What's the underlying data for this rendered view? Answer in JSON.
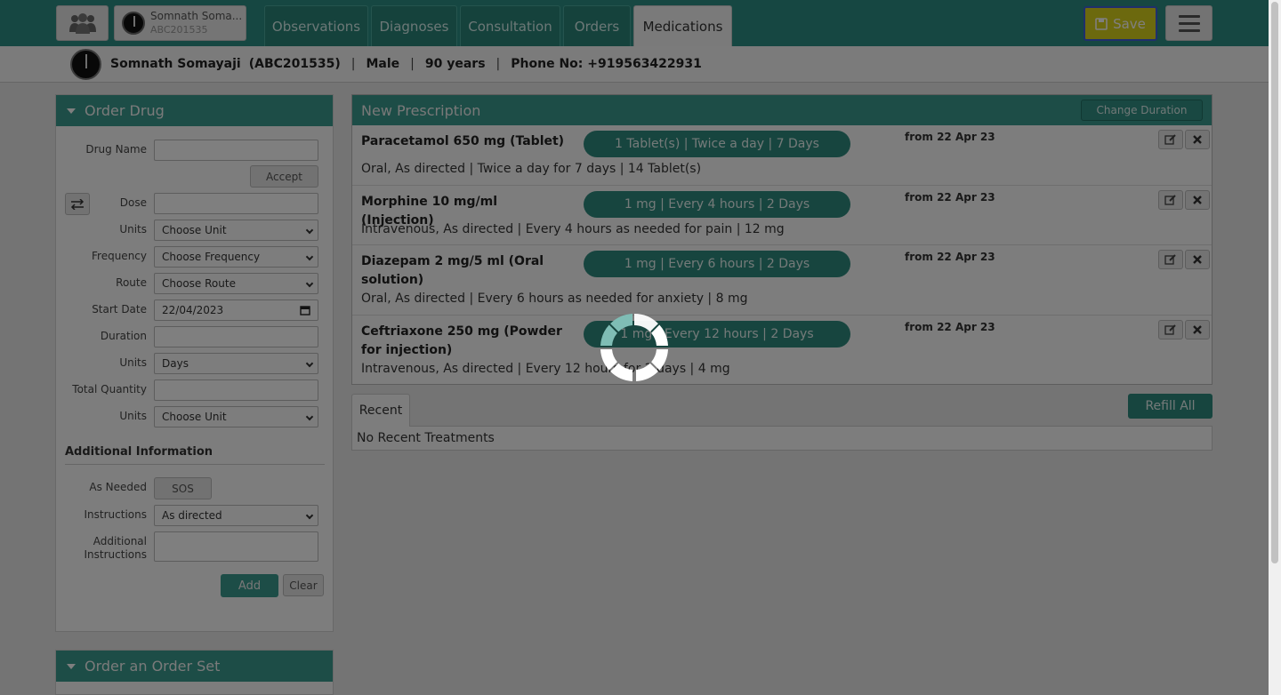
{
  "topbar": {
    "patient_chip": {
      "name": "Somnath Soma...",
      "id": "ABC201535"
    },
    "tabs": [
      {
        "label": "Observations"
      },
      {
        "label": "Diagnoses"
      },
      {
        "label": "Consultation"
      },
      {
        "label": "Orders"
      },
      {
        "label": "Medications"
      }
    ],
    "active_tab": "Medications",
    "save_label": "Save"
  },
  "patient_header": {
    "name": "Somnath Somayaji",
    "id": "(ABC201535)",
    "gender": "Male",
    "age": "90 years",
    "phone": "Phone No: +919563422931"
  },
  "order_drug": {
    "title": "Order Drug",
    "labels": {
      "drug_name": "Drug Name",
      "dose": "Dose",
      "units": "Units",
      "frequency": "Frequency",
      "route": "Route",
      "start_date": "Start Date",
      "duration": "Duration",
      "duration_units": "Units",
      "total_quantity": "Total Quantity",
      "quantity_units": "Units",
      "as_needed": "As Needed",
      "instructions": "Instructions",
      "additional_instructions": "Additional Instructions"
    },
    "accept_label": "Accept",
    "units_value": "Choose Unit",
    "frequency_value": "Choose Frequency",
    "route_value": "Choose Route",
    "start_date_value": "22/04/2023",
    "duration_units_value": "Days",
    "quantity_units_value": "Choose Unit",
    "section_title": "Additional Information",
    "sos_label": "SOS",
    "instructions_value": "As directed",
    "add_label": "Add",
    "clear_label": "Clear"
  },
  "order_set": {
    "title": "Order an Order Set"
  },
  "new_prescription": {
    "title": "New Prescription",
    "change_duration_label": "Change Duration",
    "drugs": [
      {
        "name": "Paracetamol 650 mg (Tablet)",
        "pill": "1 Tablet(s) | Twice a day | 7 Days",
        "from": "from 22 Apr 23",
        "detail": "Oral, As directed |  Twice a day for 7 days |  14 Tablet(s)"
      },
      {
        "name": "Morphine 10 mg/ml (Injection)",
        "pill": "1 mg | Every 4 hours | 2 Days",
        "from": "from 22 Apr 23",
        "detail": "Intravenous, As directed |  Every 4 hours as needed for pain |  12 mg"
      },
      {
        "name": "Diazepam 2 mg/5 ml (Oral solution)",
        "pill": "1 mg | Every 6 hours | 2 Days",
        "from": "from 22 Apr 23",
        "detail": "Oral, As directed |  Every 6 hours as needed for anxiety |  8 mg"
      },
      {
        "name": "Ceftriaxone 250 mg (Powder for injection)",
        "pill": "1 mg | Every 12 hours | 2 Days",
        "from": "from 22 Apr 23",
        "detail": "Intravenous, As directed |  Every 12 hours for 2 days |  4 mg"
      }
    ]
  },
  "recent": {
    "tab_label": "Recent",
    "refill_label": "Refill All",
    "empty_text": "No Recent Treatments"
  },
  "colors": {
    "accent": "#3a9b8f",
    "save": "#d9d21c"
  },
  "icons": [
    "people-icon",
    "save-icon",
    "menu-icon",
    "caret-down-icon",
    "swap-icon",
    "edit-icon",
    "close-icon",
    "calendar-icon",
    "loading-spinner-icon"
  ]
}
